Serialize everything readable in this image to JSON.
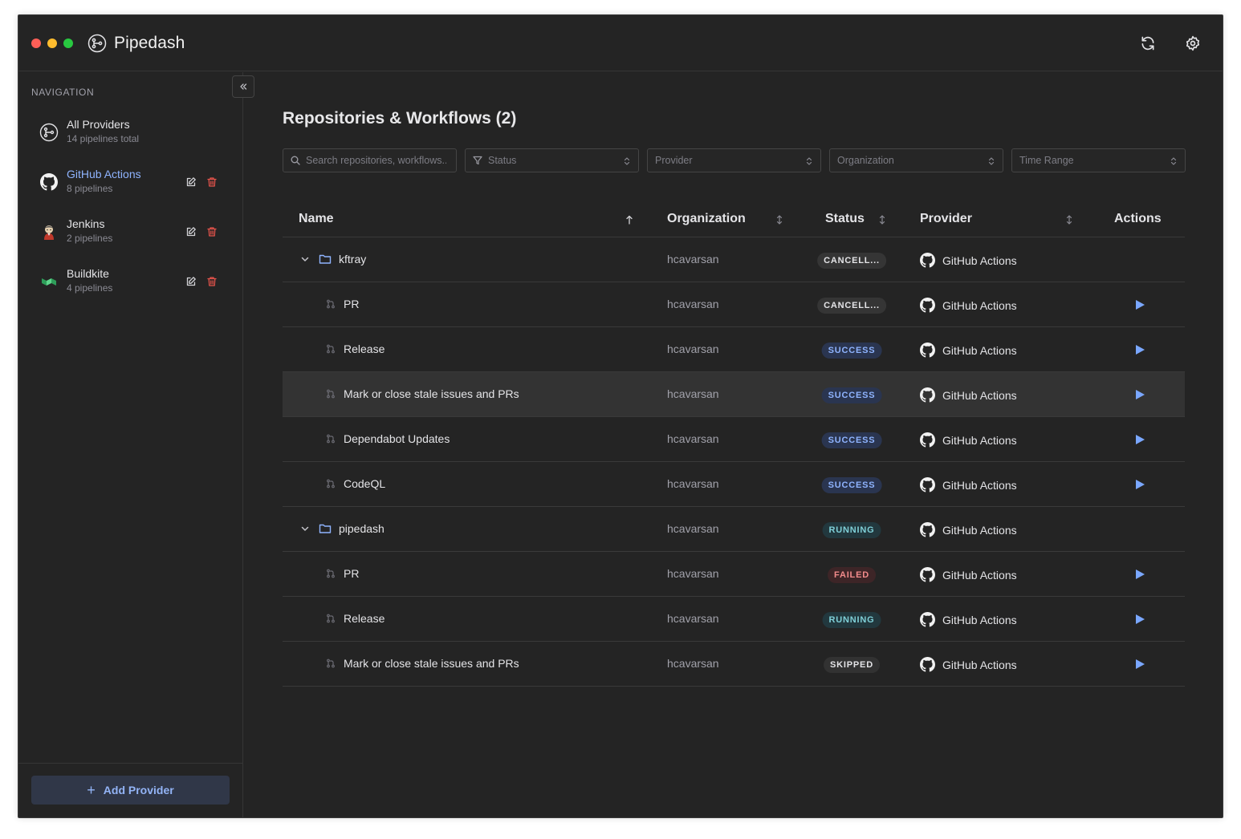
{
  "app": {
    "title": "Pipedash",
    "icons": {
      "logo": "pipeline-logo-icon",
      "refresh": "refresh-icon",
      "settings": "gear-icon"
    }
  },
  "sidebar": {
    "heading": "NAVIGATION",
    "collapse_icon": "double-chevron-left-icon",
    "items": [
      {
        "label": "All Providers",
        "sub": "14 pipelines total",
        "icon": "pipeline-logo-icon",
        "active": false
      },
      {
        "label": "GitHub Actions",
        "sub": "8 pipelines",
        "icon": "github-icon",
        "active": true
      },
      {
        "label": "Jenkins",
        "sub": "2 pipelines",
        "icon": "jenkins-icon",
        "active": false
      },
      {
        "label": "Buildkite",
        "sub": "4 pipelines",
        "icon": "buildkite-icon",
        "active": false
      }
    ],
    "add_provider": {
      "plus": "+",
      "label": "Add Provider"
    }
  },
  "main": {
    "title": "Repositories & Workflows (2)",
    "filters": {
      "search_placeholder": "Search repositories, workflows...",
      "status": "Status",
      "provider": "Provider",
      "organization": "Organization",
      "time_range": "Time Range"
    },
    "columns": {
      "name": "Name",
      "organization": "Organization",
      "status": "Status",
      "provider": "Provider",
      "actions": "Actions"
    },
    "rows": [
      {
        "type": "repo",
        "name": "kftray",
        "org": "hcavarsan",
        "status": "CANCELL...",
        "status_kind": "cancelled",
        "provider": "GitHub Actions"
      },
      {
        "type": "workflow",
        "name": "PR",
        "org": "hcavarsan",
        "status": "CANCELL...",
        "status_kind": "cancelled",
        "provider": "GitHub Actions"
      },
      {
        "type": "workflow",
        "name": "Release",
        "org": "hcavarsan",
        "status": "SUCCESS",
        "status_kind": "success",
        "provider": "GitHub Actions"
      },
      {
        "type": "workflow",
        "name": "Mark or close stale issues and PRs",
        "org": "hcavarsan",
        "status": "SUCCESS",
        "status_kind": "success",
        "provider": "GitHub Actions",
        "highlight": true
      },
      {
        "type": "workflow",
        "name": "Dependabot Updates",
        "org": "hcavarsan",
        "status": "SUCCESS",
        "status_kind": "success",
        "provider": "GitHub Actions"
      },
      {
        "type": "workflow",
        "name": "CodeQL",
        "org": "hcavarsan",
        "status": "SUCCESS",
        "status_kind": "success",
        "provider": "GitHub Actions"
      },
      {
        "type": "repo",
        "name": "pipedash",
        "org": "hcavarsan",
        "status": "RUNNING",
        "status_kind": "running",
        "provider": "GitHub Actions"
      },
      {
        "type": "workflow",
        "name": "PR",
        "org": "hcavarsan",
        "status": "FAILED",
        "status_kind": "failed",
        "provider": "GitHub Actions"
      },
      {
        "type": "workflow",
        "name": "Release",
        "org": "hcavarsan",
        "status": "RUNNING",
        "status_kind": "running",
        "provider": "GitHub Actions"
      },
      {
        "type": "workflow",
        "name": "Mark or close stale issues and PRs",
        "org": "hcavarsan",
        "status": "SKIPPED",
        "status_kind": "skipped",
        "provider": "GitHub Actions"
      }
    ]
  },
  "colors": {
    "background": "#242424",
    "accent": "#8fb4ff",
    "danger": "#e5534b",
    "run_button": "#7aa7ff"
  }
}
